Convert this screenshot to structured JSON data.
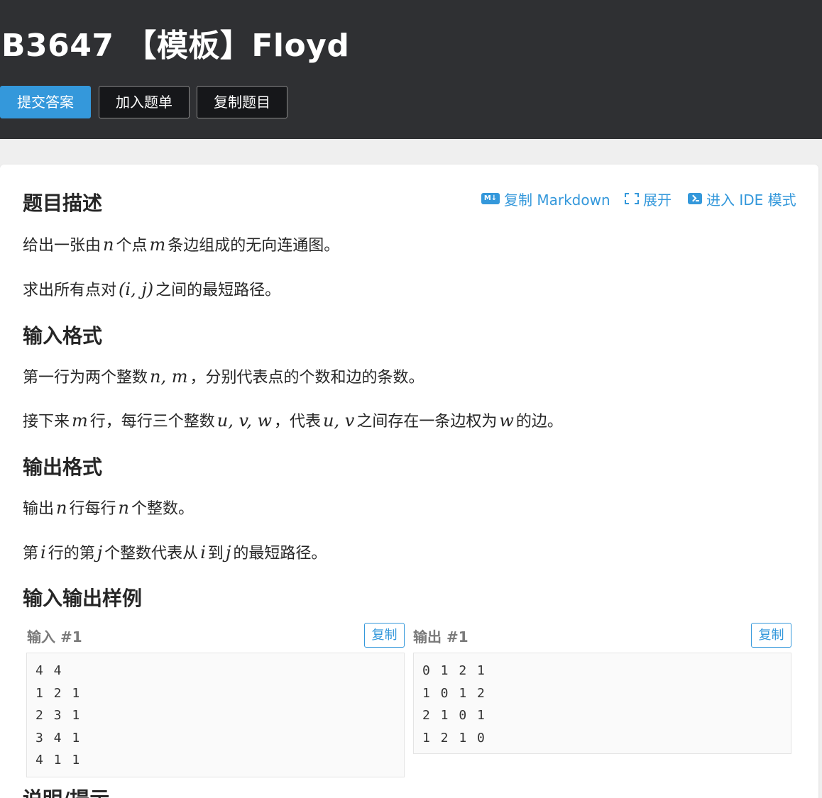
{
  "header": {
    "title": "B3647 【模板】Floyd",
    "buttons": {
      "submit": "提交答案",
      "add_to_list": "加入题单",
      "copy_problem": "复制题目"
    }
  },
  "toolbar": {
    "copy_markdown": "复制 Markdown",
    "expand": "展开",
    "ide_mode": "进入 IDE 模式",
    "markdown_icon_text": "M↓"
  },
  "sections": {
    "description": {
      "heading": "题目描述",
      "p1": {
        "a": "给出一张由",
        "n": "n",
        "b": "个点",
        "m": "m",
        "c": "条边组成的无向连通图。"
      },
      "p2": {
        "a": "求出所有点对",
        "ij": "(i, j)",
        "b": "之间的最短路径。"
      }
    },
    "input_format": {
      "heading": "输入格式",
      "p1": {
        "a": "第一行为两个整数",
        "nm": "n, m",
        "b": "，分别代表点的个数和边的条数。"
      },
      "p2": {
        "a": "接下来",
        "m": "m",
        "b": "行，每行三个整数",
        "uvw": "u, v, w",
        "c": "，代表",
        "uv": "u, v",
        "d": "之间存在一条边权为",
        "w": "w",
        "e": "的边。"
      }
    },
    "output_format": {
      "heading": "输出格式",
      "p1": {
        "a": "输出",
        "n1": "n",
        "b": "行每行",
        "n2": "n",
        "c": "个整数。"
      },
      "p2": {
        "a": "第",
        "i1": "i",
        "b": "行的第",
        "j1": "j",
        "c": "个整数代表从",
        "i2": "i",
        "d": "到",
        "j2": "j",
        "e": "的最短路径。"
      }
    },
    "samples": {
      "heading": "输入输出样例",
      "input_label": "输入 #1",
      "output_label": "输出 #1",
      "copy_label": "复制",
      "input_lines": [
        "4 4",
        "1 2 1",
        "2 3 1",
        "3 4 1",
        "4 1 1"
      ],
      "output_lines": [
        "0 1 2 1",
        "1 0 1 2",
        "2 1 0 1",
        "1 2 1 0"
      ]
    },
    "hint": {
      "heading": "说明/提示"
    }
  },
  "colors": {
    "header_bg": "#2f3033",
    "accent": "#3498db",
    "page_bg": "#efefef"
  }
}
